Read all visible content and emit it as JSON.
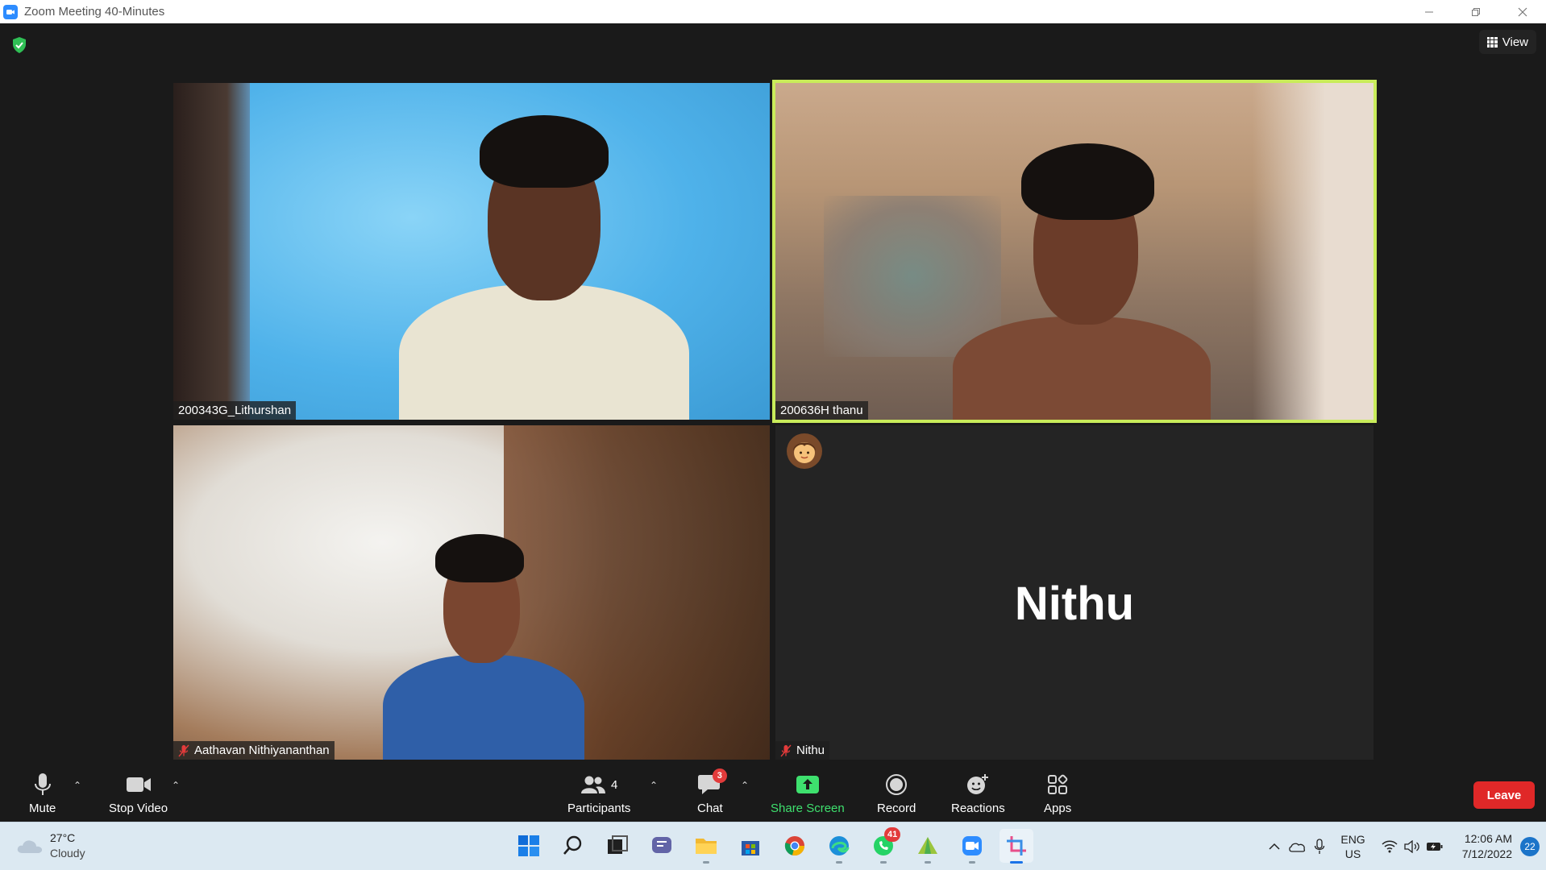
{
  "window": {
    "title": "Zoom Meeting 40-Minutes"
  },
  "header": {
    "view_label": "View"
  },
  "tiles": [
    {
      "name": "200343G_Lithurshan",
      "muted": false
    },
    {
      "name": "200636H thanu",
      "muted": false,
      "active_speaker": true
    },
    {
      "name": "Aathavan Nithiyananthan",
      "muted": true
    },
    {
      "name": "Nithu",
      "muted": true,
      "video_off": true,
      "display_name": "Nithu"
    }
  ],
  "toolbar": {
    "mute_label": "Mute",
    "stop_video_label": "Stop Video",
    "participants_label": "Participants",
    "participants_count": "4",
    "chat_label": "Chat",
    "chat_badge": "3",
    "share_screen_label": "Share Screen",
    "record_label": "Record",
    "reactions_label": "Reactions",
    "apps_label": "Apps",
    "leave_label": "Leave"
  },
  "taskbar": {
    "weather_temp": "27°C",
    "weather_condition": "Cloudy",
    "whatsapp_badge": "41",
    "lang_top": "ENG",
    "lang_bottom": "US",
    "time": "12:06 AM",
    "date": "7/12/2022",
    "notification_count": "22"
  },
  "colors": {
    "active_speaker_border": "#c9ec5a",
    "share_green": "#3ee06e",
    "leave_red": "#e02828",
    "zoom_blue": "#2d8cff"
  }
}
